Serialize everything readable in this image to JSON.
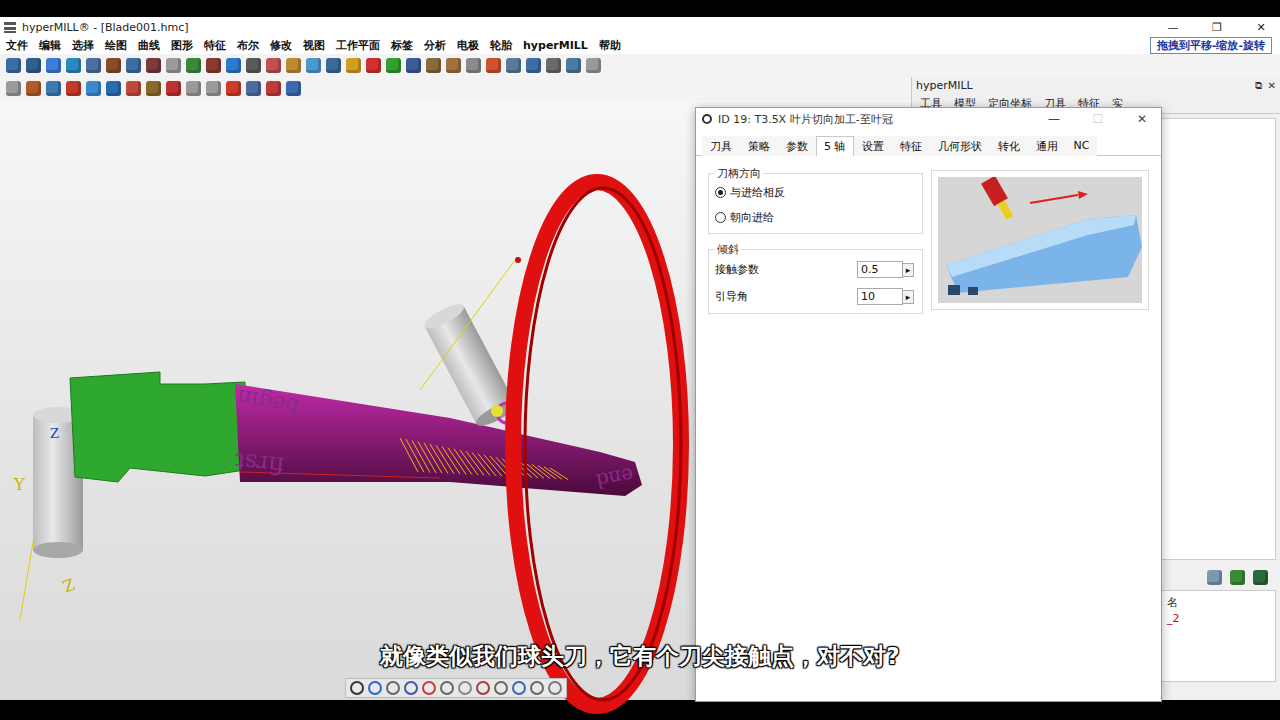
{
  "window": {
    "title": "hyperMILL® - [Blade001.hmc]",
    "controls": [
      "—",
      "❐",
      "✕"
    ]
  },
  "menu": [
    "文件",
    "编辑",
    "选择",
    "绘图",
    "曲线",
    "图形",
    "特征",
    "布尔",
    "修改",
    "视图",
    "工作平面",
    "标签",
    "分析",
    "电极",
    "轮胎",
    "hyperMILL",
    "帮助"
  ],
  "hint": "拖拽到平移-缩放-旋转",
  "viewport": {
    "labels": [
      "begin",
      "first",
      "end",
      "Z",
      "Y",
      "Z"
    ],
    "subtitle": "就像类似我们球头刀，它有个刀尖接触点，对不对?"
  },
  "side_panel": {
    "title": "hyperMILL",
    "controls": [
      "⧉",
      "✕"
    ],
    "tabs": [
      "工具",
      "模型",
      "定向坐标",
      "刀具",
      "特征",
      "实"
    ],
    "list": [
      {
        "text": "名",
        "color": "#333333"
      },
      {
        "text": "_2",
        "color": "#cc0000"
      }
    ]
  },
  "dialog": {
    "title": "ID 19: T3.5X 叶片切向加工-至叶冠",
    "controls": [
      {
        "text": "—",
        "disabled": false
      },
      {
        "text": "☐",
        "disabled": true
      },
      {
        "text": "✕",
        "disabled": false
      }
    ],
    "tabs": [
      {
        "label": "刀具",
        "selected": false
      },
      {
        "label": "策略",
        "selected": false
      },
      {
        "label": "参数",
        "selected": false
      },
      {
        "label": "5 轴",
        "selected": true
      },
      {
        "label": "设置",
        "selected": false
      },
      {
        "label": "特征",
        "selected": false
      },
      {
        "label": "几何形状",
        "selected": false
      },
      {
        "label": "转化",
        "selected": false
      },
      {
        "label": "通用",
        "selected": false
      },
      {
        "label": "NC",
        "selected": false
      }
    ],
    "orientation": {
      "legend": "刀柄方向",
      "options": [
        {
          "label": "与进给相反",
          "selected": true
        },
        {
          "label": "朝向进给",
          "selected": false
        }
      ]
    },
    "tilt": {
      "legend": "倾斜",
      "fields": [
        {
          "label": "接触参数",
          "value": "0.5",
          "spin": "▸"
        },
        {
          "label": "引导角",
          "value": "10",
          "spin": "▸"
        }
      ]
    }
  }
}
